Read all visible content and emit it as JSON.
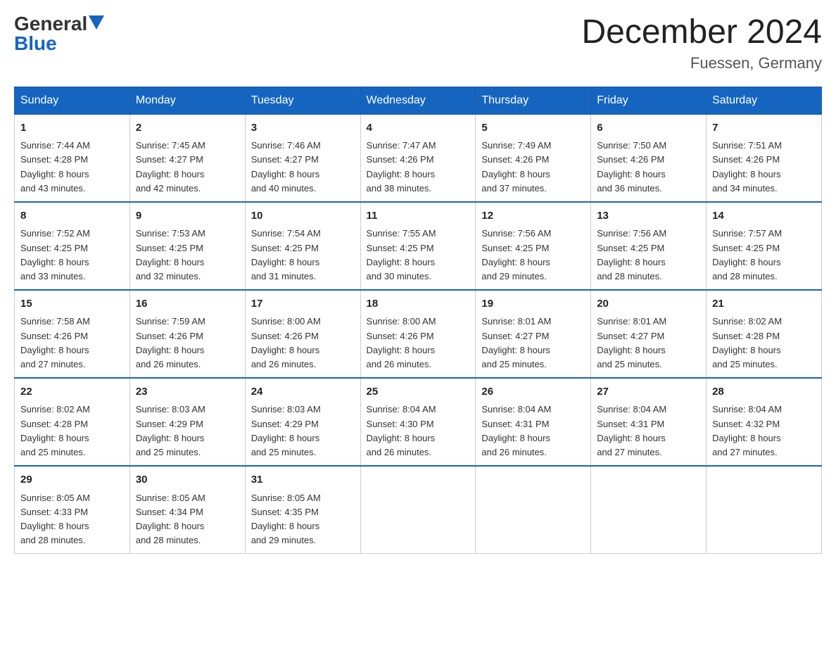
{
  "logo": {
    "general": "General",
    "blue": "Blue"
  },
  "title": "December 2024",
  "location": "Fuessen, Germany",
  "days_header": [
    "Sunday",
    "Monday",
    "Tuesday",
    "Wednesday",
    "Thursday",
    "Friday",
    "Saturday"
  ],
  "weeks": [
    [
      {
        "day": "1",
        "info": "Sunrise: 7:44 AM\nSunset: 4:28 PM\nDaylight: 8 hours\nand 43 minutes."
      },
      {
        "day": "2",
        "info": "Sunrise: 7:45 AM\nSunset: 4:27 PM\nDaylight: 8 hours\nand 42 minutes."
      },
      {
        "day": "3",
        "info": "Sunrise: 7:46 AM\nSunset: 4:27 PM\nDaylight: 8 hours\nand 40 minutes."
      },
      {
        "day": "4",
        "info": "Sunrise: 7:47 AM\nSunset: 4:26 PM\nDaylight: 8 hours\nand 38 minutes."
      },
      {
        "day": "5",
        "info": "Sunrise: 7:49 AM\nSunset: 4:26 PM\nDaylight: 8 hours\nand 37 minutes."
      },
      {
        "day": "6",
        "info": "Sunrise: 7:50 AM\nSunset: 4:26 PM\nDaylight: 8 hours\nand 36 minutes."
      },
      {
        "day": "7",
        "info": "Sunrise: 7:51 AM\nSunset: 4:26 PM\nDaylight: 8 hours\nand 34 minutes."
      }
    ],
    [
      {
        "day": "8",
        "info": "Sunrise: 7:52 AM\nSunset: 4:25 PM\nDaylight: 8 hours\nand 33 minutes."
      },
      {
        "day": "9",
        "info": "Sunrise: 7:53 AM\nSunset: 4:25 PM\nDaylight: 8 hours\nand 32 minutes."
      },
      {
        "day": "10",
        "info": "Sunrise: 7:54 AM\nSunset: 4:25 PM\nDaylight: 8 hours\nand 31 minutes."
      },
      {
        "day": "11",
        "info": "Sunrise: 7:55 AM\nSunset: 4:25 PM\nDaylight: 8 hours\nand 30 minutes."
      },
      {
        "day": "12",
        "info": "Sunrise: 7:56 AM\nSunset: 4:25 PM\nDaylight: 8 hours\nand 29 minutes."
      },
      {
        "day": "13",
        "info": "Sunrise: 7:56 AM\nSunset: 4:25 PM\nDaylight: 8 hours\nand 28 minutes."
      },
      {
        "day": "14",
        "info": "Sunrise: 7:57 AM\nSunset: 4:25 PM\nDaylight: 8 hours\nand 28 minutes."
      }
    ],
    [
      {
        "day": "15",
        "info": "Sunrise: 7:58 AM\nSunset: 4:26 PM\nDaylight: 8 hours\nand 27 minutes."
      },
      {
        "day": "16",
        "info": "Sunrise: 7:59 AM\nSunset: 4:26 PM\nDaylight: 8 hours\nand 26 minutes."
      },
      {
        "day": "17",
        "info": "Sunrise: 8:00 AM\nSunset: 4:26 PM\nDaylight: 8 hours\nand 26 minutes."
      },
      {
        "day": "18",
        "info": "Sunrise: 8:00 AM\nSunset: 4:26 PM\nDaylight: 8 hours\nand 26 minutes."
      },
      {
        "day": "19",
        "info": "Sunrise: 8:01 AM\nSunset: 4:27 PM\nDaylight: 8 hours\nand 25 minutes."
      },
      {
        "day": "20",
        "info": "Sunrise: 8:01 AM\nSunset: 4:27 PM\nDaylight: 8 hours\nand 25 minutes."
      },
      {
        "day": "21",
        "info": "Sunrise: 8:02 AM\nSunset: 4:28 PM\nDaylight: 8 hours\nand 25 minutes."
      }
    ],
    [
      {
        "day": "22",
        "info": "Sunrise: 8:02 AM\nSunset: 4:28 PM\nDaylight: 8 hours\nand 25 minutes."
      },
      {
        "day": "23",
        "info": "Sunrise: 8:03 AM\nSunset: 4:29 PM\nDaylight: 8 hours\nand 25 minutes."
      },
      {
        "day": "24",
        "info": "Sunrise: 8:03 AM\nSunset: 4:29 PM\nDaylight: 8 hours\nand 25 minutes."
      },
      {
        "day": "25",
        "info": "Sunrise: 8:04 AM\nSunset: 4:30 PM\nDaylight: 8 hours\nand 26 minutes."
      },
      {
        "day": "26",
        "info": "Sunrise: 8:04 AM\nSunset: 4:31 PM\nDaylight: 8 hours\nand 26 minutes."
      },
      {
        "day": "27",
        "info": "Sunrise: 8:04 AM\nSunset: 4:31 PM\nDaylight: 8 hours\nand 27 minutes."
      },
      {
        "day": "28",
        "info": "Sunrise: 8:04 AM\nSunset: 4:32 PM\nDaylight: 8 hours\nand 27 minutes."
      }
    ],
    [
      {
        "day": "29",
        "info": "Sunrise: 8:05 AM\nSunset: 4:33 PM\nDaylight: 8 hours\nand 28 minutes."
      },
      {
        "day": "30",
        "info": "Sunrise: 8:05 AM\nSunset: 4:34 PM\nDaylight: 8 hours\nand 28 minutes."
      },
      {
        "day": "31",
        "info": "Sunrise: 8:05 AM\nSunset: 4:35 PM\nDaylight: 8 hours\nand 29 minutes."
      },
      {
        "day": "",
        "info": ""
      },
      {
        "day": "",
        "info": ""
      },
      {
        "day": "",
        "info": ""
      },
      {
        "day": "",
        "info": ""
      }
    ]
  ]
}
